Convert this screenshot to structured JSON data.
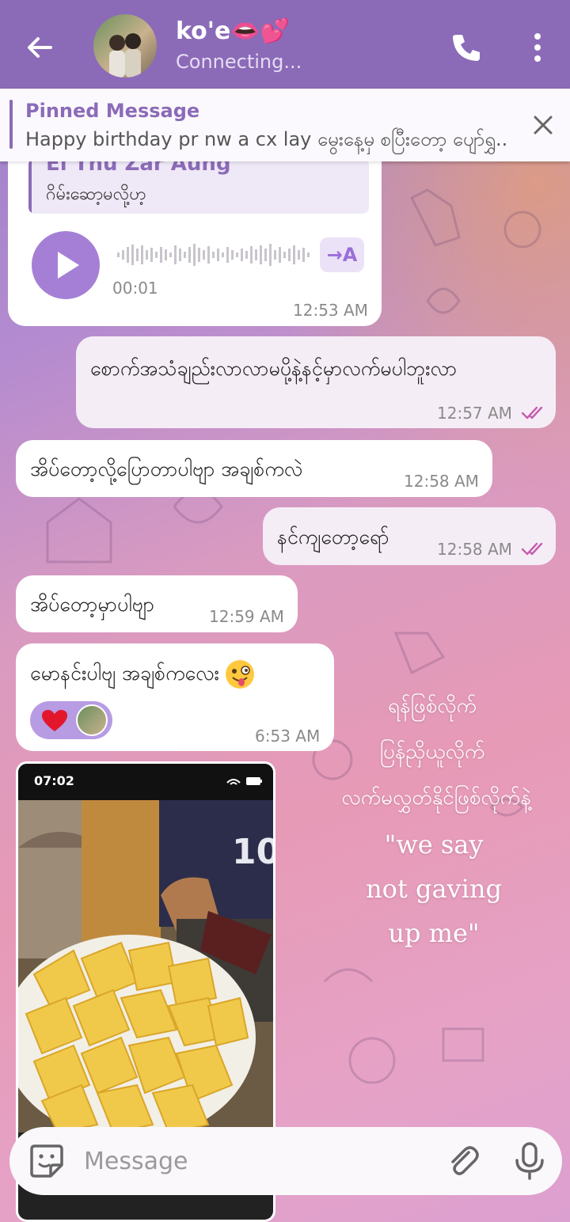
{
  "header": {
    "chat_name": "ko'e👄💕",
    "status": "Connecting..."
  },
  "pinned": {
    "title": "Pinned Message",
    "text": "Happy birthday pr nw a cx lay မွေးနေ့မှ စပြီးတော့ ပျော်ရွှ..."
  },
  "messages": {
    "voice": {
      "reply_name": "Ei Thu Zar Aung",
      "reply_text": "ဂိမ်းဆော့မလို့ဟ့",
      "duration": "00:01",
      "transcribe_label": "→A",
      "time": "12:53 AM"
    },
    "m1": {
      "text": "စောက်အသံချည်းလာလာမပို့နဲ့နင့်မှာလက်မပါဘူးလာ",
      "time": "12:57 AM"
    },
    "m2": {
      "text": "အိပ်တော့လို့ပြောတာပါဗျာ အချစ်ကလဲ",
      "time": "12:58 AM"
    },
    "m3": {
      "text": "နင်ကျတော့ရော်",
      "time": "12:58 AM"
    },
    "m4": {
      "text": "အိပ်တော့မှာပါဗျာ",
      "time": "12:59 AM"
    },
    "m5": {
      "text": "မောနင်းပါဗျ အချစ်ကလေး",
      "time": "6:53 AM"
    },
    "photo": {
      "status_time": "07:02"
    }
  },
  "overlay": {
    "line1": "ရန်ဖြစ်လိုက်",
    "line2": "ပြန်ညှိယူလိုက်",
    "line3": "လက်မလွှတ်နိုင်ဖြစ်လိုက်နဲ့",
    "line4": "\"we say",
    "line5": "not gaving",
    "line6": "up me\""
  },
  "input": {
    "placeholder": "Message"
  },
  "colors": {
    "header": "#8b6bb8",
    "accent": "#a57fd6",
    "read_ticks": "#c45fb0"
  },
  "icons": {
    "back": "arrow-left-icon",
    "call": "phone-icon",
    "more": "more-vertical-icon",
    "close": "close-icon",
    "play": "play-icon",
    "sticker": "sticker-icon",
    "attach": "paperclip-icon",
    "mic": "microphone-icon"
  }
}
